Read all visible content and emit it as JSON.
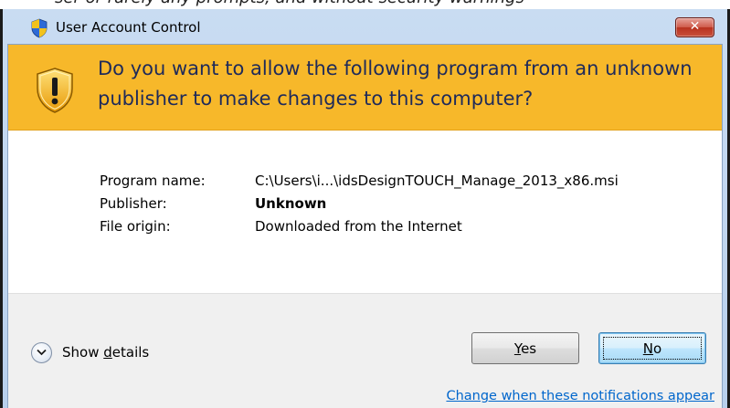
{
  "window": {
    "title": "User Account Control",
    "close_label": "✕"
  },
  "banner": {
    "prompt": "Do you want to allow the following program from an unknown publisher to make changes to this computer?"
  },
  "info": {
    "rows": [
      {
        "label": "Program name:",
        "value": "C:\\Users\\i...\\idsDesignTOUCH_Manage_2013_x86.msi"
      },
      {
        "label": "Publisher:",
        "value": "Unknown"
      },
      {
        "label": "File origin:",
        "value": "Downloaded from the Internet"
      }
    ]
  },
  "footer": {
    "details_prefix": "Show ",
    "details_mnemonic": "d",
    "details_suffix": "etails",
    "yes_mnemonic": "Y",
    "yes_rest": "es",
    "no_mnemonic": "N",
    "no_rest": "o",
    "change_link": "Change when these notifications appear"
  },
  "colors": {
    "banner": "#f7b82a",
    "link": "#0066cc",
    "banner_text": "#1e2a5a"
  }
}
